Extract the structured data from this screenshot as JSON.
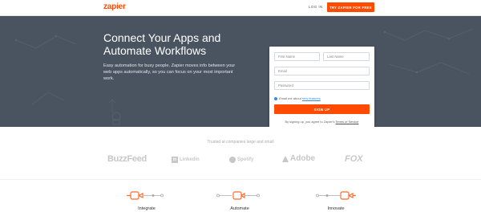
{
  "header": {
    "logo": "zapier",
    "login_label": "LOG IN",
    "try_label": "TRY ZAPIER FOR FREE",
    "brand_color": "#ff4a00"
  },
  "hero": {
    "title": "Connect Your Apps and Automate Workflows",
    "description": "Easy automation for busy people. Zapier moves info between your web apps automatically, so you can focus on your most important work.",
    "background": "#4a5461"
  },
  "form": {
    "first_name_placeholder": "First Name",
    "last_name_placeholder": "Last Name",
    "email_placeholder": "Email",
    "password_placeholder": "Password",
    "opt_in_prefix": "Email me about",
    "opt_in_link": "new features",
    "submit_label": "SIGN UP",
    "terms_prefix": "By signing up, you agree to Zapier's",
    "terms_link": "Terms of Service",
    "accent_color": "#3d8bd6"
  },
  "trusted": {
    "label": "Trusted at companies large and small",
    "logos": [
      {
        "name": "BuzzFeed",
        "icon": "buzzfeed-logo"
      },
      {
        "name": "Linkedin",
        "icon": "linkedin-logo"
      },
      {
        "name": "Spotify",
        "icon": "spotify-logo"
      },
      {
        "name": "Adobe",
        "icon": "adobe-logo"
      },
      {
        "name": "FOX",
        "icon": "fox-logo"
      }
    ]
  },
  "features": [
    {
      "label": "Integrate",
      "icon": "integrate-icon"
    },
    {
      "label": "Automate",
      "icon": "automate-icon"
    },
    {
      "label": "Innovate",
      "icon": "innovate-icon"
    }
  ]
}
